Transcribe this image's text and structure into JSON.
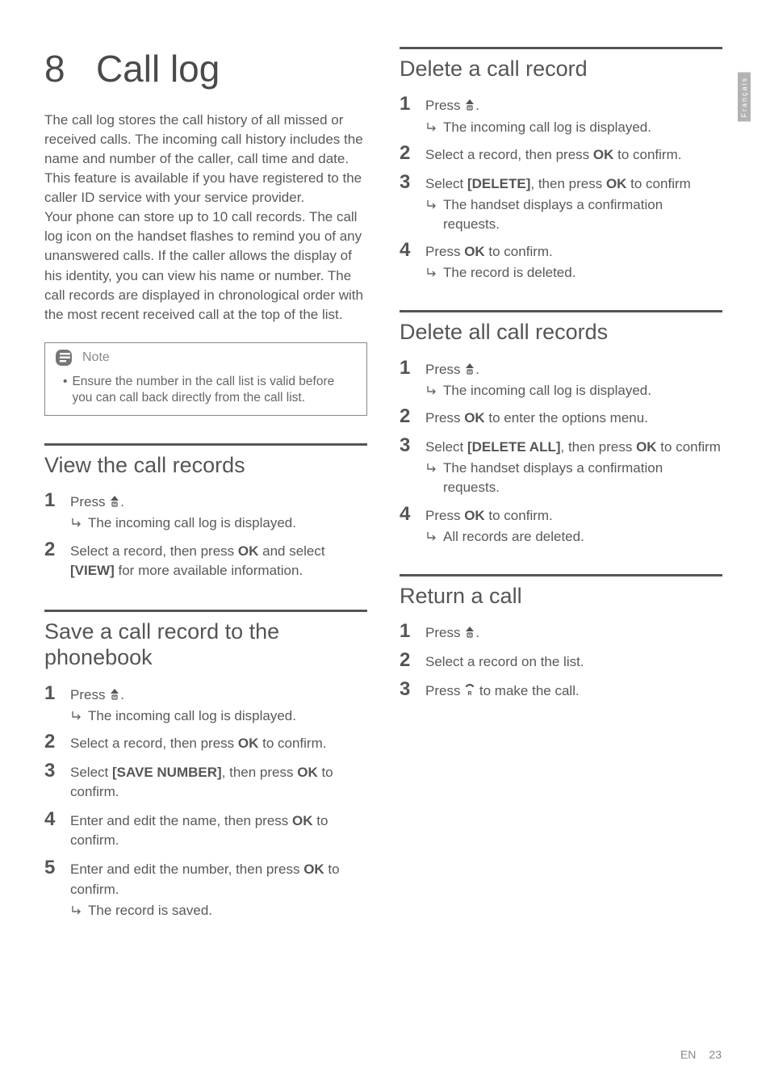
{
  "chapter": {
    "number": "8",
    "title": "Call log"
  },
  "intro_p1": "The call log stores the call history of all missed or received calls. The incoming call history includes the name and number of the caller, call time and date. This feature is available if you have registered to the caller ID service with your service provider.",
  "intro_p2": "Your phone can store up to 10 call records. The call log icon on the handset flashes to remind you of any unanswered calls. If the caller allows the display of his identity, you can view his name or number. The call records are displayed in chronological order with the most recent received call at the top of the list.",
  "note": {
    "label": "Note",
    "text": "Ensure the number in the call list is valid before you can call back directly from the call list."
  },
  "sections": {
    "view": {
      "title": "View the call records",
      "s1_press": "Press ",
      "s1_result": "The incoming call log is displayed.",
      "s2_a": "Select a record, then press ",
      "s2_ok": "OK",
      "s2_b": " and select ",
      "s2_view": "[VIEW]",
      "s2_c": " for more available information."
    },
    "save": {
      "title": "Save a call record to the phonebook",
      "s1_press": "Press ",
      "s1_result": "The incoming call log is displayed.",
      "s2_a": "Select a record, then press ",
      "s2_ok": "OK",
      "s2_b": " to confirm.",
      "s3_a": "Select ",
      "s3_cmd": "[SAVE NUMBER]",
      "s3_b": ", then press ",
      "s3_ok": "OK",
      "s3_c": " to confirm.",
      "s4_a": "Enter and edit the name, then press ",
      "s4_ok": "OK",
      "s4_b": " to confirm.",
      "s5_a": "Enter and edit the number, then press ",
      "s5_ok": "OK",
      "s5_b": " to confirm.",
      "s5_result": "The record is saved."
    },
    "delete": {
      "title": "Delete a call record",
      "s1_press": "Press ",
      "s1_result": "The incoming call log is displayed.",
      "s2_a": "Select a record, then press ",
      "s2_ok": "OK",
      "s2_b": " to confirm.",
      "s3_a": "Select ",
      "s3_cmd": "[DELETE]",
      "s3_b": ", then press ",
      "s3_ok": "OK",
      "s3_c": " to confirm",
      "s3_result": "The handset displays a confirmation requests.",
      "s4_a": "Press ",
      "s4_ok": "OK",
      "s4_b": " to confirm.",
      "s4_result": "The record is deleted."
    },
    "deleteall": {
      "title": "Delete all call records",
      "s1_press": "Press ",
      "s1_result": "The incoming call log is displayed.",
      "s2_a": "Press ",
      "s2_ok": "OK",
      "s2_b": " to enter the options menu.",
      "s3_a": "Select ",
      "s3_cmd": "[DELETE ALL]",
      "s3_b": ", then press ",
      "s3_ok": "OK",
      "s3_c": " to confirm",
      "s3_result": "The handset displays a confirmation requests.",
      "s4_a": "Press ",
      "s4_ok": "OK",
      "s4_b": " to confirm.",
      "s4_result": "All records are deleted."
    },
    "return": {
      "title": "Return a call",
      "s1_press": "Press ",
      "s2": "Select a record on the list.",
      "s3_a": "Press ",
      "s3_b": " to make the call."
    }
  },
  "sidetab": "Français",
  "footer": {
    "lang": "EN",
    "page": "23"
  },
  "icons": {
    "up": "up-icon",
    "phone": "phone-icon",
    "note": "note-icon",
    "arrow": "arrow-icon"
  }
}
